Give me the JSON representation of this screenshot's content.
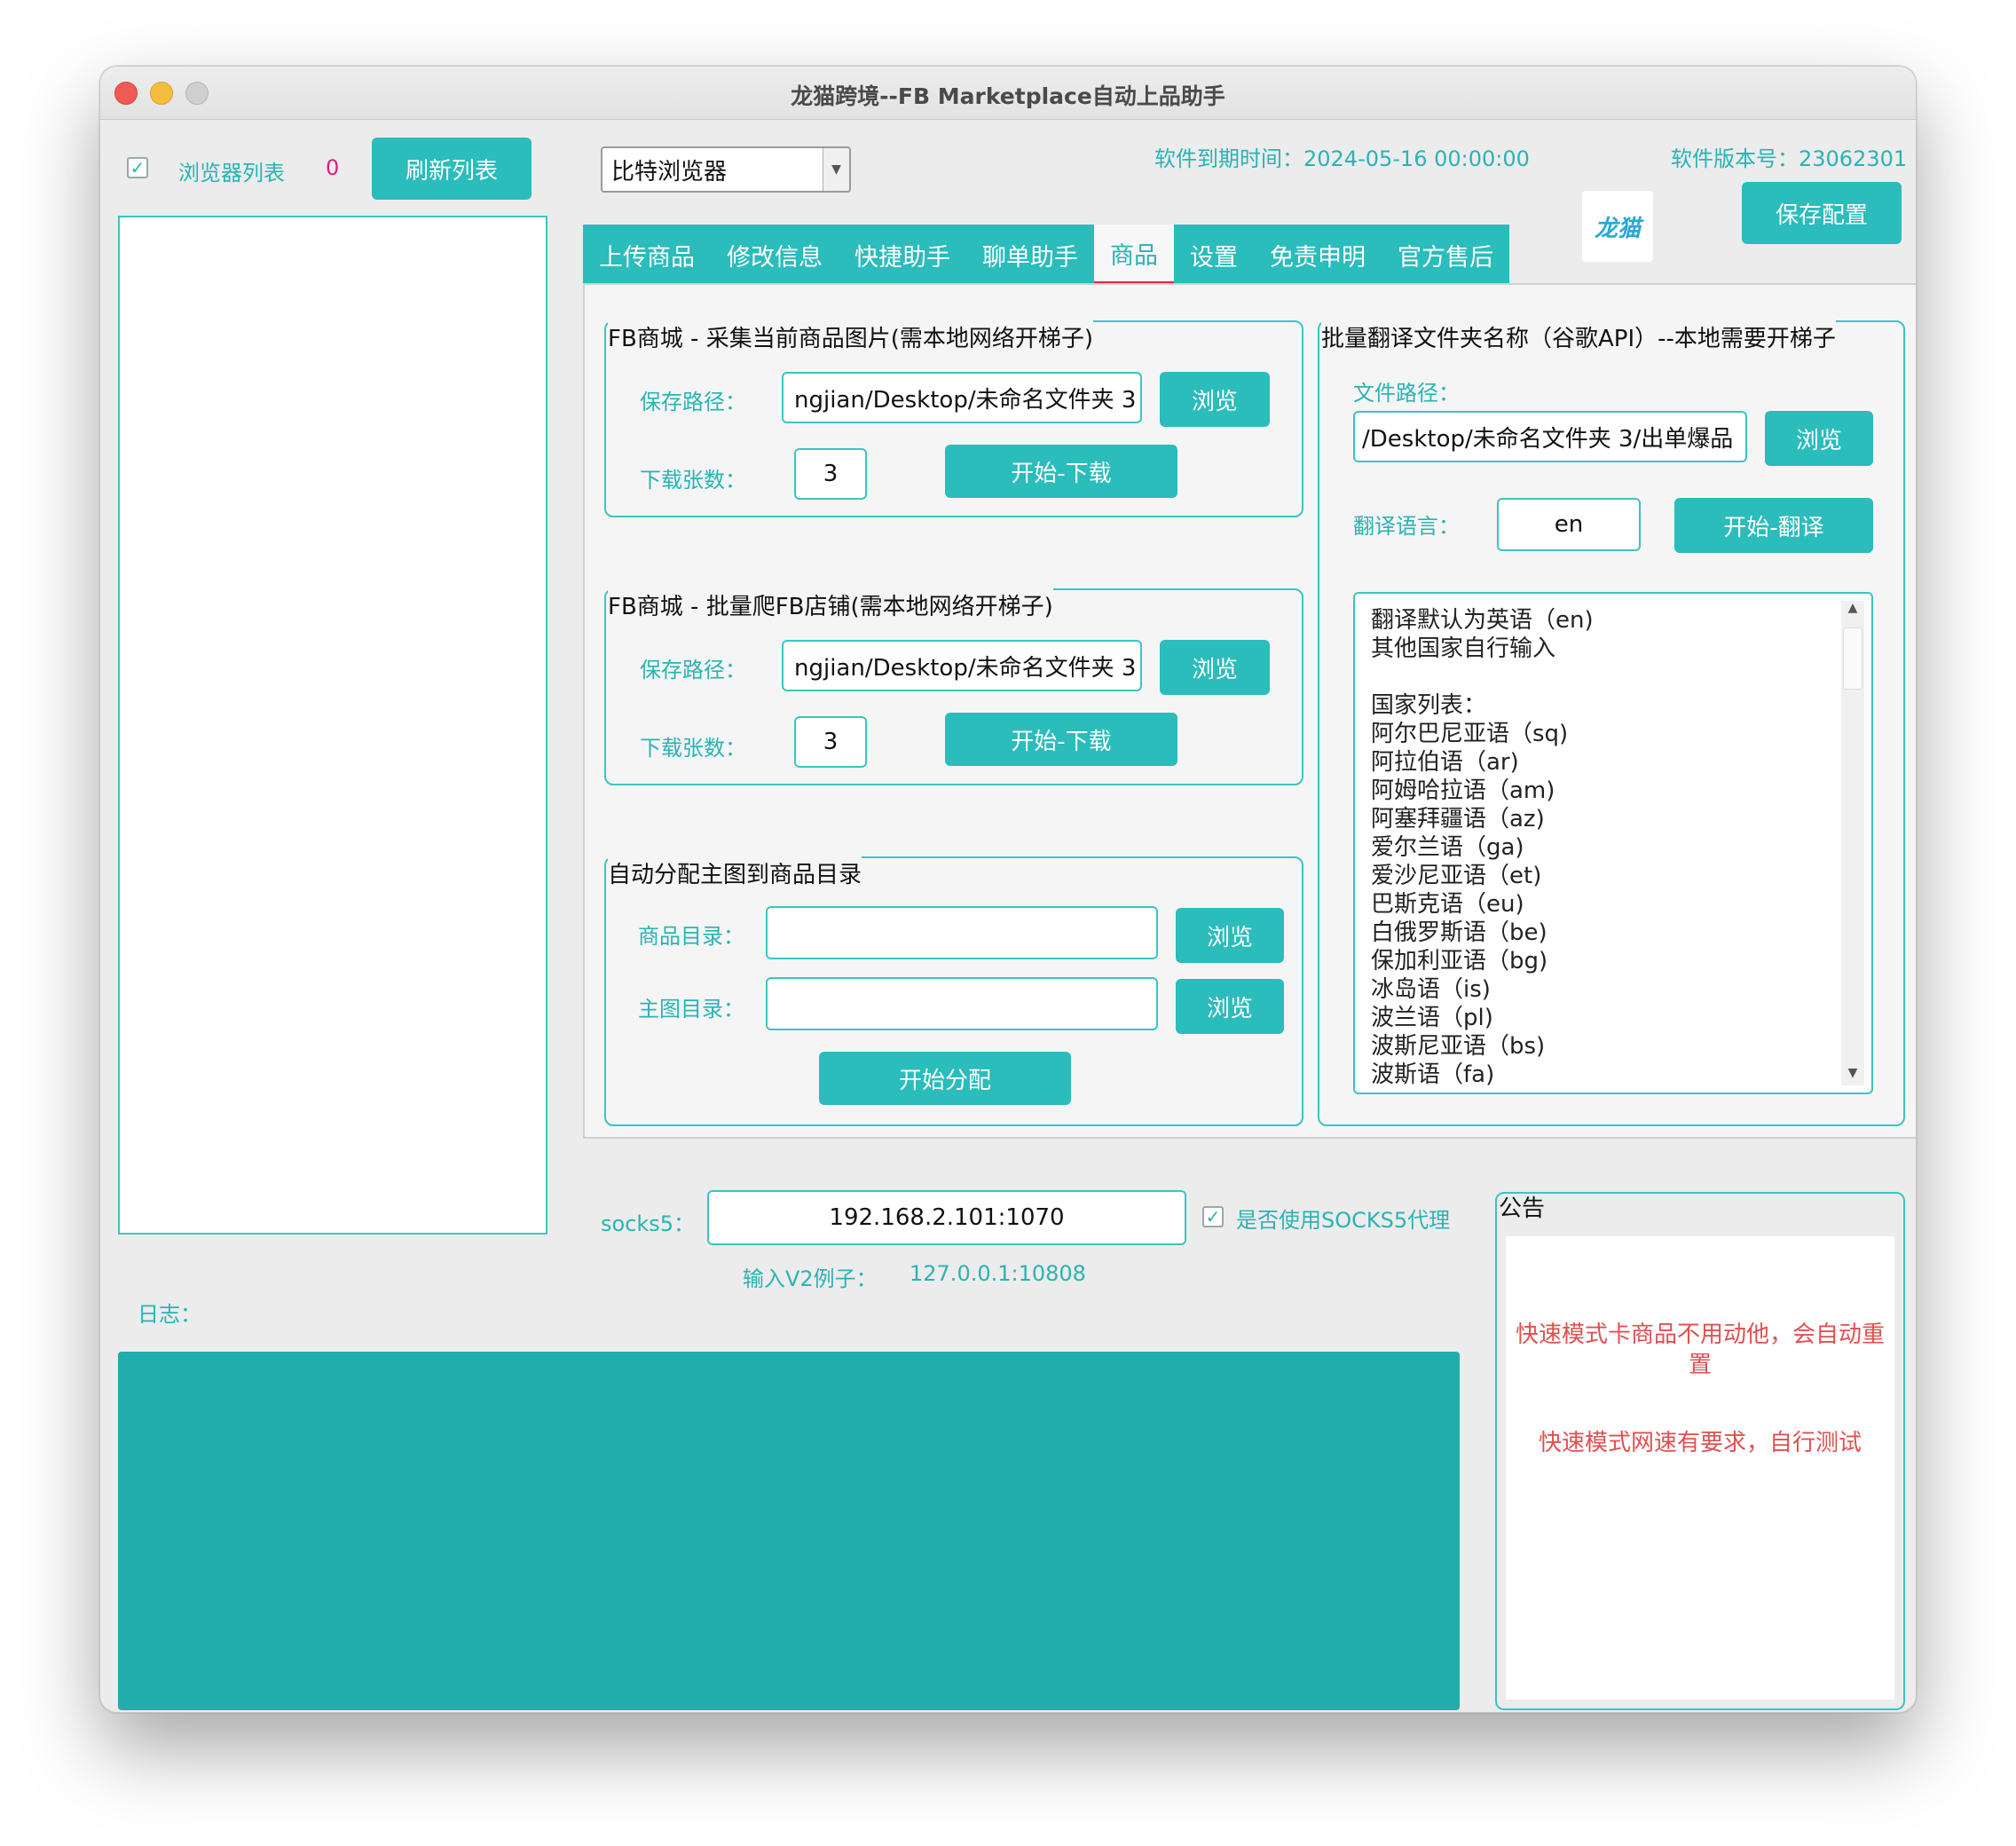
{
  "window": {
    "title": "龙猫跨境--FB Marketplace自动上品助手"
  },
  "header": {
    "browser_list_label": "浏览器列表",
    "browser_count": "0",
    "refresh_button": "刷新列表",
    "browser_select_value": "比特浏览器",
    "expiry_label": "软件到期时间：2024-05-16 00:00:00",
    "version_label": "软件版本号：23062301",
    "logo_text": "龙猫",
    "save_config_button": "保存配置"
  },
  "tabs": [
    {
      "label": "上传商品",
      "active": false
    },
    {
      "label": "修改信息",
      "active": false
    },
    {
      "label": "快捷助手",
      "active": false
    },
    {
      "label": "聊单助手",
      "active": false
    },
    {
      "label": "商品",
      "active": true
    },
    {
      "label": "设置",
      "active": false
    },
    {
      "label": "免责申明",
      "active": false
    },
    {
      "label": "官方售后",
      "active": false
    }
  ],
  "collect": {
    "title": "FB商城 - 采集当前商品图片(需本地网络开梯子)",
    "save_path_label": "保存路径：",
    "save_path_value": "ngjian/Desktop/未命名文件夹 3",
    "browse_button": "浏览",
    "count_label": "下载张数：",
    "count_value": "3",
    "start_button": "开始-下载"
  },
  "crawl": {
    "title": "FB商城 - 批量爬FB店铺(需本地网络开梯子)",
    "save_path_label": "保存路径：",
    "save_path_value": "ngjian/Desktop/未命名文件夹 3",
    "browse_button": "浏览",
    "count_label": "下载张数：",
    "count_value": "3",
    "start_button": "开始-下载"
  },
  "assign": {
    "title": "自动分配主图到商品目录",
    "product_dir_label": "商品目录：",
    "product_dir_value": "",
    "main_img_dir_label": "主图目录：",
    "main_img_dir_value": "",
    "browse_button_1": "浏览",
    "browse_button_2": "浏览",
    "start_button": "开始分配"
  },
  "translate": {
    "title": "批量翻译文件夹名称（谷歌API）--本地需要开梯子",
    "file_path_label": "文件路径：",
    "file_path_value": "/Desktop/未命名文件夹 3/出单爆品",
    "browse_button": "浏览",
    "lang_label": "翻译语言：",
    "lang_value": "en",
    "start_button": "开始-翻译",
    "info_lines": [
      "翻译默认为英语（en)",
      "其他国家自行输入",
      "",
      "国家列表：",
      "阿尔巴尼亚语（sq)",
      "阿拉伯语（ar)",
      "阿姆哈拉语（am)",
      "阿塞拜疆语（az)",
      "爱尔兰语（ga)",
      "爱沙尼亚语（et)",
      "巴斯克语（eu)",
      "白俄罗斯语（be)",
      "保加利亚语（bg)",
      "冰岛语（is)",
      "波兰语（pl)",
      "波斯尼亚语（bs)",
      "波斯语（fa)"
    ]
  },
  "proxy": {
    "socks5_label": "socks5：",
    "socks5_value": "192.168.2.101:1070",
    "use_socks5_label": "是否使用SOCKS5代理",
    "example_label": "输入V2例子：",
    "example_value": "127.0.0.1:10808"
  },
  "log": {
    "label": "日志："
  },
  "notice": {
    "title": "公告",
    "line1": "快速模式卡商品不用动他，会自动重置",
    "line2": "快速模式网速有要求，自行测试"
  },
  "colors": {
    "accent": "#2bbcbc",
    "log_bg": "#20adab",
    "tab_indicator": "#e0283a",
    "notice_text": "#e05050",
    "count_pink": "#e0207a"
  }
}
